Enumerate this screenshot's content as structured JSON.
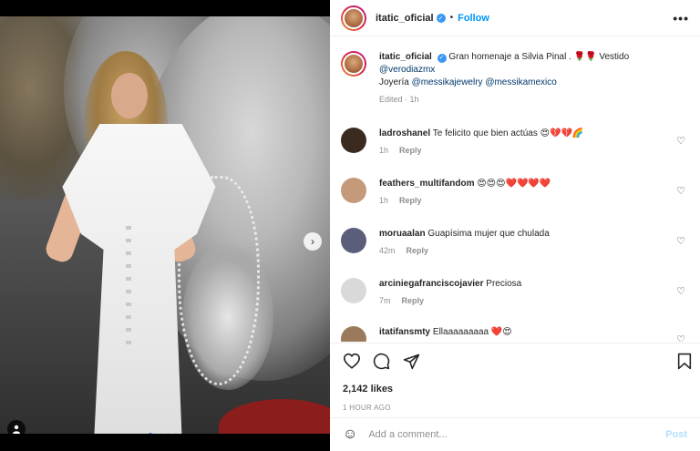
{
  "post": {
    "username": "itatic_oficial",
    "follow_label": "Follow",
    "dot": "•",
    "more_label": "•••"
  },
  "caption": {
    "username": "itatic_oficial",
    "text": "Gran homenaje a Silvia Pinal . 🌹🌹 Vestido",
    "mention1": "@verodiazmx",
    "joyeria_label": "Joyería",
    "mention2": "@messikajewelry",
    "mention3": "@messikamexico",
    "meta": "Edited · 1h"
  },
  "comments": [
    {
      "username": "ladroshanel",
      "text": "Te felicito que bien actúas 😍💔💔🌈",
      "time": "1h",
      "reply": "Reply",
      "avatar_color": "#3a2a1f"
    },
    {
      "username": "feathers_multifandom",
      "text": "😍😍😍❤️❤️❤️❤️",
      "time": "1h",
      "reply": "Reply",
      "avatar_color": "#c49a7a"
    },
    {
      "username": "moruaalan",
      "text": "Guapísima mujer que chulada",
      "time": "42m",
      "reply": "Reply",
      "avatar_color": "#5b5e7a"
    },
    {
      "username": "arciniegafranciscojavier",
      "text": "Preciosa",
      "time": "7m",
      "reply": "Reply",
      "avatar_color": "#d9d9d9"
    },
    {
      "username": "itatifansmty",
      "text": "Ellaaaaaaaaa ❤️😍",
      "time": "",
      "reply": "",
      "avatar_color": "#9a7a5a"
    }
  ],
  "actions": {
    "like_icon": "heart-outline-icon",
    "comment_icon": "comment-icon",
    "share_icon": "send-icon",
    "save_icon": "bookmark-icon"
  },
  "likes": "2,142 likes",
  "time_ago": "1 HOUR AGO",
  "add_comment": {
    "placeholder": "Add a comment...",
    "post_label": "Post"
  },
  "carousel": {
    "count": 4,
    "active_index": 0
  }
}
